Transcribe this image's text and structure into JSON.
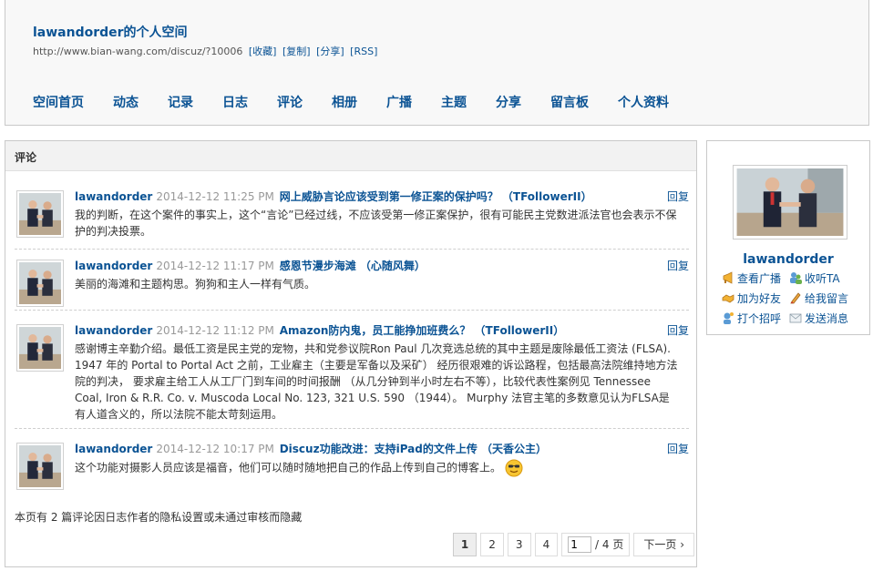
{
  "space": {
    "title": "lawandorder的个人空间",
    "url": "http://www.bian-wang.com/discuz/?10006",
    "links": [
      "[收藏]",
      "[复制]",
      "[分享]",
      "[RSS]"
    ]
  },
  "nav": [
    "空间首页",
    "动态",
    "记录",
    "日志",
    "评论",
    "相册",
    "广播",
    "主题",
    "分享",
    "留言板",
    "个人资料"
  ],
  "main": {
    "title": "评论",
    "reply_label": "回复",
    "comments": [
      {
        "user": "lawandorder",
        "time": "2014-12-12 11:25 PM",
        "topic": "网上威胁言论应该受到第一修正案的保护吗？ （TFollowerII）",
        "body": "我的判断，在这个案件的事实上，这个“言论”已经过线，不应该受第一修正案保护，很有可能民主党数进派法官也会表示不保护的判决投票。"
      },
      {
        "user": "lawandorder",
        "time": "2014-12-12 11:17 PM",
        "topic": "感恩节漫步海滩 （心随风舞）",
        "body": "美丽的海滩和主题构思。狗狗和主人一样有气质。"
      },
      {
        "user": "lawandorder",
        "time": "2014-12-12 11:12 PM",
        "topic": "Amazon防内鬼，员工能挣加班费么？ （TFollowerII）",
        "body": "感谢博主辛勤介绍。最低工资是民主党的宠物，共和党参议院Ron Paul 几次竞选总统的其中主题是废除最低工资法 (FLSA). 1947 年的 Portal to Portal Act 之前，工业雇主（主要是军备以及采矿） 经历很艰难的诉讼路程，包括最高法院维持地方法院的判决， 要求雇主给工人从工厂门到车间的时间报酬 （从几分钟到半小时左右不等），比较代表性案例见 Tennessee Coal, Iron & R.R. Co. v. Muscoda Local No. 123, 321 U.S. 590 （1944）。 Murphy 法官主笔的多数意见认为FLSA是有人道含义的，所以法院不能太苛刻运用。"
      },
      {
        "user": "lawandorder",
        "time": "2014-12-12 10:17 PM",
        "topic": "Discuz功能改进：支持iPad的文件上传 （天香公主）",
        "body": "这个功能对摄影人员应该是福音，他们可以随时随地把自己的作品上传到自己的博客上。"
      }
    ],
    "hidden_note": "本页有 2 篇评论因日志作者的隐私设置或未通过审核而隐藏",
    "pager": {
      "pages": [
        "1",
        "2",
        "3",
        "4"
      ],
      "current": "1",
      "jump_value": "1",
      "total_label": "/ 4 页",
      "next_label": "下一页"
    }
  },
  "sidebar": {
    "name": "lawandorder",
    "actions": [
      {
        "label": "查看广播",
        "icon": "megaphone-icon"
      },
      {
        "label": "收听TA",
        "icon": "follow-users-icon"
      },
      {
        "label": "加为好友",
        "icon": "handshake-icon"
      },
      {
        "label": "给我留言",
        "icon": "pencil-icon"
      },
      {
        "label": "打个招呼",
        "icon": "greet-user-icon"
      },
      {
        "label": "发送消息",
        "icon": "envelope-icon"
      }
    ]
  },
  "colors": {
    "link": "#0b5394",
    "header_bg": "#f8f8f8",
    "border": "#c9c9c9"
  }
}
